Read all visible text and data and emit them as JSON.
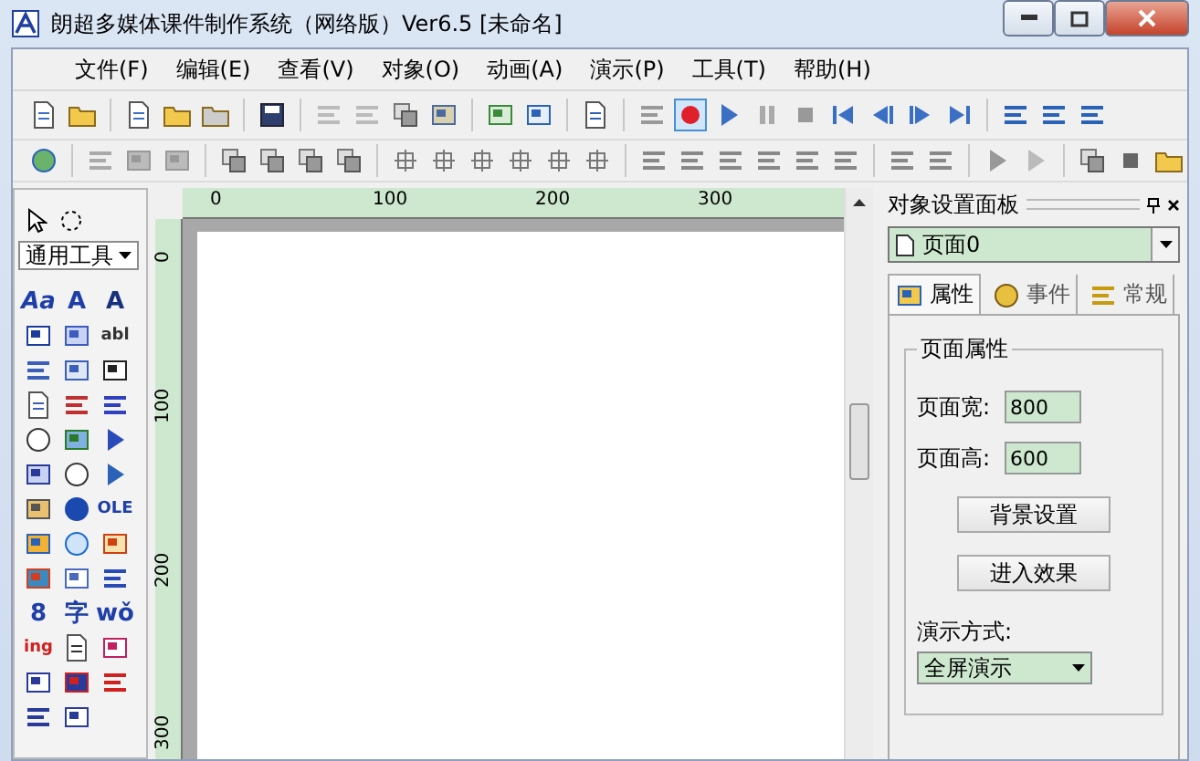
{
  "window": {
    "title": "朗超多媒体课件制作系统（网络版）Ver6.5 [未命名]"
  },
  "menu": [
    "文件(F)",
    "编辑(E)",
    "查看(V)",
    "对象(O)",
    "动画(A)",
    "演示(P)",
    "工具(T)",
    "帮助(H)"
  ],
  "toolbar": {
    "record_pressed": true
  },
  "toolbox": {
    "category": "通用工具",
    "tools": [
      {
        "kind": "glyph",
        "glyph": "Aa",
        "color": "#1f3fa8"
      },
      {
        "kind": "glyph",
        "glyph": "A",
        "color": "#1f3fa8"
      },
      {
        "kind": "glyph",
        "glyph": "A",
        "color": "#16307e"
      },
      {
        "kind": "icon"
      },
      {
        "kind": "icon"
      },
      {
        "kind": "glyph",
        "glyph": "abl",
        "color": "#333333"
      },
      {
        "kind": "icon"
      },
      {
        "kind": "icon"
      },
      {
        "kind": "icon"
      },
      {
        "kind": "icon"
      },
      {
        "kind": "icon"
      },
      {
        "kind": "icon"
      },
      {
        "kind": "icon"
      },
      {
        "kind": "icon"
      },
      {
        "kind": "icon"
      },
      {
        "kind": "icon"
      },
      {
        "kind": "icon"
      },
      {
        "kind": "icon"
      },
      {
        "kind": "icon"
      },
      {
        "kind": "icon"
      },
      {
        "kind": "glyph",
        "glyph": "OLE",
        "color": "#1f3fa8"
      },
      {
        "kind": "icon"
      },
      {
        "kind": "icon"
      },
      {
        "kind": "icon"
      },
      {
        "kind": "icon"
      },
      {
        "kind": "icon"
      },
      {
        "kind": "icon"
      },
      {
        "kind": "glyph",
        "glyph": "8",
        "color": "#1f3fa8"
      },
      {
        "kind": "glyph",
        "glyph": "字",
        "color": "#1f3fa8"
      },
      {
        "kind": "glyph",
        "glyph": "wǒ",
        "color": "#1f3fa8"
      },
      {
        "kind": "glyph",
        "glyph": "ing",
        "color": "#d02020"
      },
      {
        "kind": "icon"
      },
      {
        "kind": "icon"
      },
      {
        "kind": "icon"
      },
      {
        "kind": "icon"
      },
      {
        "kind": "icon"
      },
      {
        "kind": "icon"
      },
      {
        "kind": "icon"
      }
    ]
  },
  "rulers": {
    "horizontal": [
      "0",
      "100",
      "200",
      "300"
    ],
    "vertical": [
      "0",
      "100",
      "200",
      "300"
    ]
  },
  "panel": {
    "title": "对象设置面板",
    "object": "页面0",
    "tabs": [
      {
        "label": "属性",
        "selected": true
      },
      {
        "label": "事件",
        "selected": false
      },
      {
        "label": "常规",
        "selected": false
      }
    ],
    "group": "页面属性",
    "fields": [
      {
        "label": "页面宽:",
        "value": "800"
      },
      {
        "label": "页面高:",
        "value": "600"
      }
    ],
    "buttons": [
      "背景设置",
      "进入效果"
    ],
    "mode_label": "演示方式:",
    "mode": "全屏演示"
  }
}
